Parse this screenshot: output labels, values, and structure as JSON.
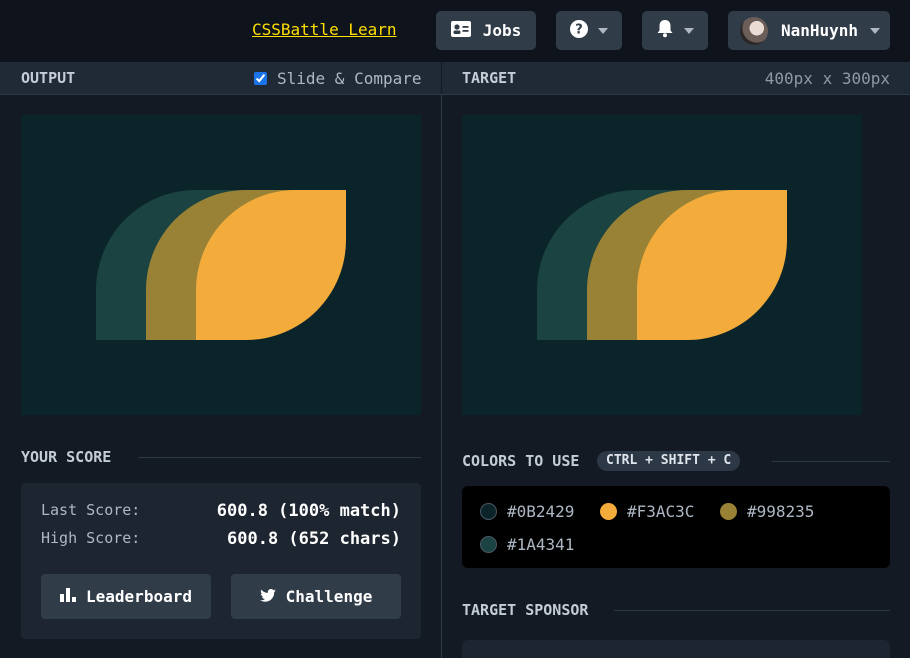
{
  "topbar": {
    "learn_link": "CSSBattle Learn",
    "jobs_label": "Jobs",
    "username": "NanHuynh"
  },
  "output_panel": {
    "title": "OUTPUT",
    "slide_compare_label": "Slide & Compare",
    "slide_compare_checked": true
  },
  "target_panel": {
    "title": "TARGET",
    "dimensions": "400px x 300px"
  },
  "score": {
    "title": "YOUR SCORE",
    "last_label": "Last Score:",
    "last_value": "600.8 (100% match)",
    "high_label": "High Score:",
    "high_value": "600.8 (652 chars)",
    "leaderboard_label": "Leaderboard",
    "challenge_label": "Challenge"
  },
  "colors": {
    "title": "COLORS TO USE",
    "shortcut": "CTRL + SHIFT + C",
    "swatches": [
      {
        "hex": "#0B2429",
        "label": "#0B2429"
      },
      {
        "hex": "#F3AC3C",
        "label": "#F3AC3C"
      },
      {
        "hex": "#998235",
        "label": "#998235"
      },
      {
        "hex": "#1A4341",
        "label": "#1A4341"
      }
    ]
  },
  "sponsor": {
    "title": "TARGET SPONSOR"
  },
  "theme": {
    "accent_link": "#ffdf00",
    "background": "#0B2429",
    "teal": "#1A4341",
    "olive": "#998235",
    "orange": "#F3AC3C"
  }
}
